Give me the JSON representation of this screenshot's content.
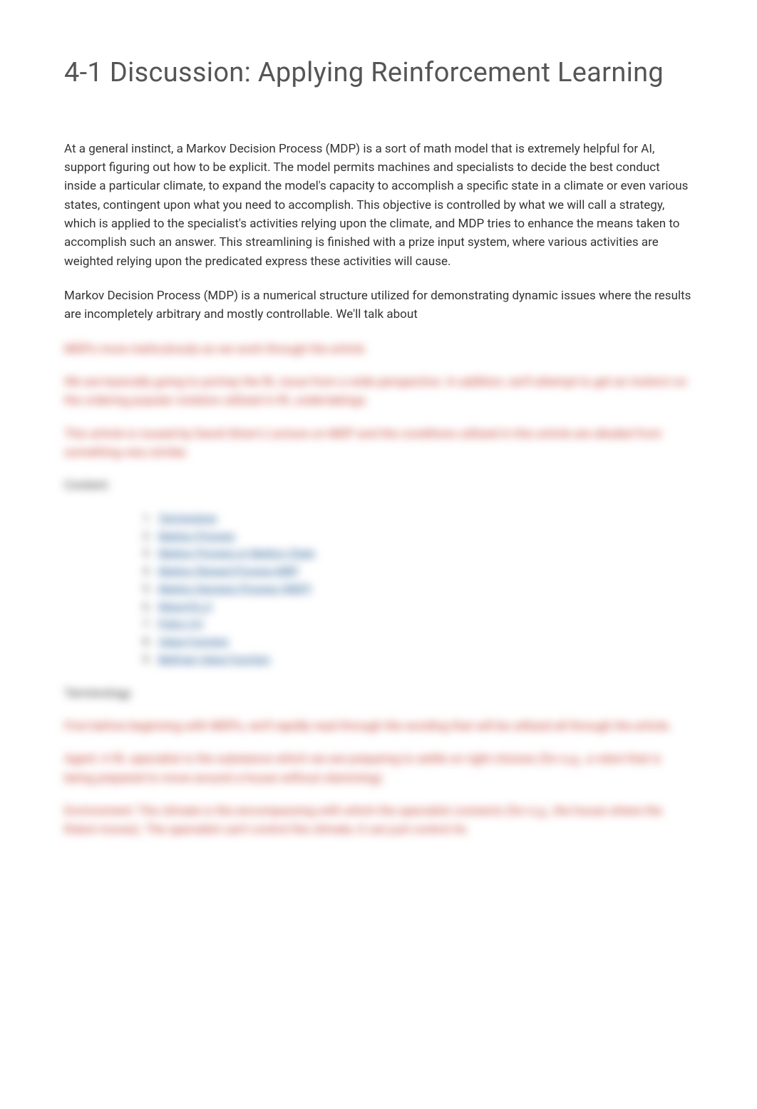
{
  "title": "4-1 Discussion: Applying Reinforcement Learning",
  "paragraph1": "At a general instinct, a Markov Decision Process (MDP) is a sort of math model that is extremely helpful for AI, support figuring out how to be explicit. The model permits machines and specialists to decide the best conduct inside a particular climate, to expand the model's capacity to accomplish a specific state in a climate or even various states, contingent upon what you need to accomplish. This objective is controlled by what we will call a strategy, which is applied to the specialist's activities relying upon the climate, and MDP tries to enhance the means taken to accomplish such an answer. This streamlining is finished with a prize input system, where various activities are weighted relying upon the predicated express these activities will cause.",
  "paragraph2": "Markov Decision Process (MDP) is a numerical structure utilized for demonstrating dynamic issues where the results are incompletely arbitrary and mostly controllable. We'll talk about",
  "blurred": {
    "line1": "MDPs more meticulously as we work through the article.",
    "line2": "We are basically going to portray the RL issue from a wide perspective. In addition, we'll attempt to get an instinct on the ordering popular notation utilized in RL undertakings.",
    "line3": "This article is roused by David Silver's Lecture on MDP and the conditions utilized in this article are alluded from something very similar.",
    "contentLabel": "Content:",
    "listItems": [
      "Terminology",
      "Markov Process",
      "Markov Process or Markov Chain",
      "Markov Reward Process MRP",
      "Markov Decision Process (MDP)",
      "Return(G_t)",
      "Policy (π)",
      "Value Function",
      "Bellman Value Function"
    ],
    "terminologyLabel": "Terminology",
    "line4": "First before beginning with MDPs, we'll rapidly read through the wording that will be utilized all through the article.",
    "line5": "Agent: A RL specialist is the substance which we are preparing to settle on right choices (for e.g., a robot that is being prepared to move around a house without slamming).",
    "line6": "Environment: The climate is the encompassing with which the specialist connects (for e.g., the house where the Robot moves). The specialist can't control the climate, it can just control its"
  }
}
